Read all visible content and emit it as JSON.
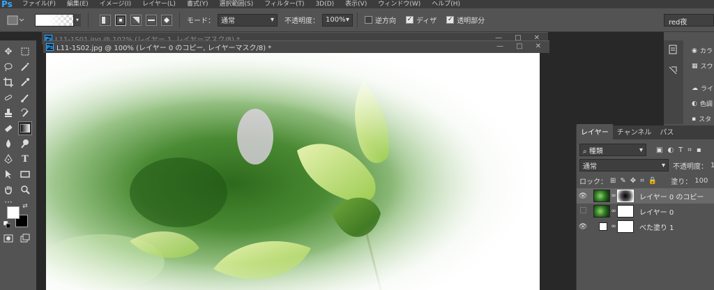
{
  "app": {
    "logo": "Ps"
  },
  "menu": [
    "ファイル(F)",
    "編集(E)",
    "イメージ(I)",
    "レイヤー(L)",
    "書式(Y)",
    "選択範囲(S)",
    "フィルター(T)",
    "3D(D)",
    "表示(V)",
    "ウィンドウ(W)",
    "ヘルプ(H)"
  ],
  "options": {
    "mode_label": "モード：",
    "mode_value": "通常",
    "opacity_label": "不透明度：",
    "opacity_value": "100%",
    "reverse_label": "逆方向",
    "dither_label": "ディザ",
    "transparency_label": "透明部分",
    "reverse_checked": false,
    "dither_checked": true,
    "transparency_checked": true,
    "search_value": "red夜"
  },
  "documents": {
    "back_title": "L11-1S01.jpg @ 102% (レイヤー 1, レイヤーマスク/8) *",
    "front_title": "L11-1S02.jpg @ 100% (レイヤー 0 のコピー, レイヤーマスク/8) *",
    "min": "—",
    "max": "□",
    "close": "✕"
  },
  "right_panel": {
    "items": [
      "カラ",
      "スウ",
      "ライ",
      "色調",
      "スタ"
    ]
  },
  "layers_panel": {
    "tabs": [
      "レイヤー",
      "チャンネル",
      "パス"
    ],
    "filter_label": "種類",
    "blend_mode": "通常",
    "opacity_label": "不透明度：",
    "opacity_value": "100",
    "lock_label": "ロック：",
    "fill_label": "塗り：",
    "fill_value": "100",
    "layers": [
      {
        "name": "レイヤー 0 のコピー",
        "visible": true,
        "selected": true
      },
      {
        "name": "レイヤー 0",
        "visible": false,
        "selected": false
      },
      {
        "name": "べた塗り 1",
        "visible": true,
        "selected": false
      }
    ]
  },
  "colors": {
    "accent": "#31a8ff",
    "panel": "#535353",
    "dark": "#282828"
  }
}
